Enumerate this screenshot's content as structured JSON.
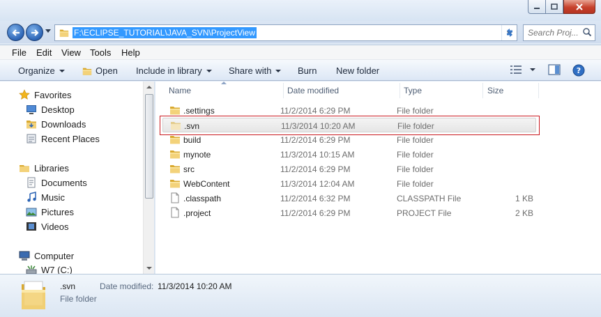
{
  "address": {
    "path": "F:\\ECLIPSE_TUTORIAL\\JAVA_SVN\\ProjectView"
  },
  "search": {
    "placeholder": "Search Proj..."
  },
  "menu": {
    "file": "File",
    "edit": "Edit",
    "view": "View",
    "tools": "Tools",
    "help": "Help"
  },
  "toolbar": {
    "organize": "Organize",
    "open": "Open",
    "include": "Include in library",
    "share": "Share with",
    "burn": "Burn",
    "new_folder": "New folder"
  },
  "nav": {
    "favorites": "Favorites",
    "desktop": "Desktop",
    "downloads": "Downloads",
    "recent": "Recent Places",
    "libraries": "Libraries",
    "documents": "Documents",
    "music": "Music",
    "pictures": "Pictures",
    "videos": "Videos",
    "computer": "Computer",
    "drive": "W7 (C:)"
  },
  "columns": {
    "name": "Name",
    "date": "Date modified",
    "type": "Type",
    "size": "Size"
  },
  "files": [
    {
      "name": ".settings",
      "date": "11/2/2014 6:29 PM",
      "type": "File folder",
      "size": "",
      "icon": "folder"
    },
    {
      "name": ".svn",
      "date": "11/3/2014 10:20 AM",
      "type": "File folder",
      "size": "",
      "icon": "folder-faded",
      "selected": true
    },
    {
      "name": "build",
      "date": "11/2/2014 6:29 PM",
      "type": "File folder",
      "size": "",
      "icon": "folder"
    },
    {
      "name": "mynote",
      "date": "11/3/2014 10:15 AM",
      "type": "File folder",
      "size": "",
      "icon": "folder"
    },
    {
      "name": "src",
      "date": "11/2/2014 6:29 PM",
      "type": "File folder",
      "size": "",
      "icon": "folder"
    },
    {
      "name": "WebContent",
      "date": "11/3/2014 12:04 AM",
      "type": "File folder",
      "size": "",
      "icon": "folder"
    },
    {
      "name": ".classpath",
      "date": "11/2/2014 6:32 PM",
      "type": "CLASSPATH File",
      "size": "1 KB",
      "icon": "file"
    },
    {
      "name": ".project",
      "date": "11/2/2014 6:29 PM",
      "type": "PROJECT File",
      "size": "2 KB",
      "icon": "file"
    }
  ],
  "details": {
    "name": ".svn",
    "date_label": "Date modified:",
    "date_value": "11/3/2014 10:20 AM",
    "type": "File folder"
  },
  "colors": {
    "selection": "#3399ff",
    "highlight_border": "#c9171e",
    "folder": "#e9c15a"
  }
}
